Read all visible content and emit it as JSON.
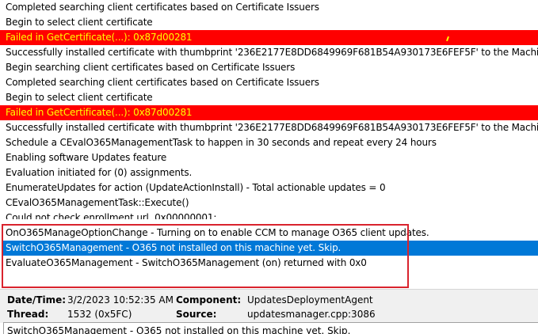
{
  "log": {
    "entries": [
      {
        "text": "Completed searching client certificates based on Certificate Issuers",
        "type": "normal"
      },
      {
        "text": "Begin to select client certificate",
        "type": "normal"
      },
      {
        "text": "Failed in GetCertificate(...): 0x87d00281",
        "type": "error"
      },
      {
        "text": "Successfully installed certificate with thumbprint '236E2177E8DD6849969F681B54A930173E6FEF5F' to the Machine\\TrustedPublis",
        "type": "normal"
      },
      {
        "text": "Begin searching client certificates based on Certificate Issuers",
        "type": "normal"
      },
      {
        "text": "Completed searching client certificates based on Certificate Issuers",
        "type": "normal"
      },
      {
        "text": "Begin to select client certificate",
        "type": "normal"
      },
      {
        "text": "Failed in GetCertificate(...): 0x87d00281",
        "type": "error"
      },
      {
        "text": "Successfully installed certificate with thumbprint '236E2177E8DD6849969F681B54A930173E6FEF5F' to the Machine\\Root store.",
        "type": "normal"
      },
      {
        "text": "Schedule a CEvalO365ManagementTask to happen in 30 seconds and repeat every 24 hours",
        "type": "normal"
      },
      {
        "text": "Enabling software Updates feature",
        "type": "normal"
      },
      {
        "text": "Evaluation initiated for (0) assignments.",
        "type": "normal"
      },
      {
        "text": "EnumerateUpdates for action (UpdateActionInstall) - Total actionable updates = 0",
        "type": "normal"
      },
      {
        "text": "CEvalO365ManagementTask::Execute()",
        "type": "normal"
      },
      {
        "text": "Could not check enrollment url, 0x00000001:",
        "type": "clipped"
      },
      {
        "text": "OnO365ManageOptionChange - Turning on to enable CCM to manage O365 client updates.",
        "type": "normal"
      },
      {
        "text": "SwitchO365Management - O365 not installed on this machine yet. Skip.",
        "type": "selected"
      },
      {
        "text": "EvaluateO365Management - SwitchO365Management (on) returned with 0x0",
        "type": "normal"
      }
    ]
  },
  "details": {
    "date_time_label": "Date/Time:",
    "date_time_value": "3/2/2023 10:52:35 AM",
    "component_label": "Component:",
    "component_value": "UpdatesDeploymentAgent",
    "thread_label": "Thread:",
    "thread_value": "1532 (0x5FC)",
    "source_label": "Source:",
    "source_value": "updatesmanager.cpp:3086"
  },
  "message": {
    "text": "SwitchO365Management - O365 not installed on this machine yet. Skip."
  },
  "colors": {
    "error_bg": "#ff0000",
    "error_text": "#ffff00",
    "selected_bg": "#0078d7",
    "highlight_border": "#d9232d"
  }
}
